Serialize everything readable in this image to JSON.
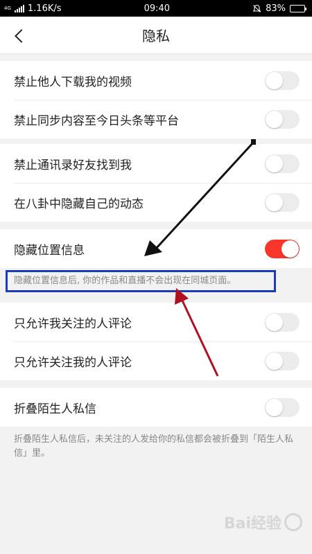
{
  "status_bar": {
    "network": "4G",
    "speed": "1.16K/s",
    "time": "09:40",
    "battery_text": "83%",
    "battery_level": 0.83,
    "bell_icon": "bell-muted-icon"
  },
  "nav": {
    "back_icon": "chevron-left-icon",
    "title": "隐私"
  },
  "groups": [
    {
      "items": [
        {
          "label": "禁止他人下载我的视频",
          "on": false
        },
        {
          "label": "禁止同步内容至今日头条等平台",
          "on": false
        }
      ]
    },
    {
      "items": [
        {
          "label": "禁止通讯录好友找到我",
          "on": false
        },
        {
          "label": "在八卦中隐藏自己的动态",
          "on": false
        }
      ]
    },
    {
      "items": [
        {
          "label": "隐藏位置信息",
          "on": true
        }
      ],
      "hint": "隐藏位置信息后, 你的作品和直播不会出现在同城页面。"
    },
    {
      "items": [
        {
          "label": "只允许我关注的人评论",
          "on": false
        },
        {
          "label": "只允许关注我的人评论",
          "on": false
        }
      ]
    },
    {
      "items": [
        {
          "label": "折叠陌生人私信",
          "on": false
        }
      ],
      "hint": "折叠陌生人私信后，未关注的人发给你的私信都会被折叠到「陌生人私信」里。"
    }
  ],
  "colors": {
    "toggle_on": "#f8352a",
    "toggle_off": "#ececec",
    "highlight_box": "#1b3ab8",
    "arrow_black": "#111111",
    "arrow_red": "#b01020"
  },
  "watermark": "Bai经验"
}
